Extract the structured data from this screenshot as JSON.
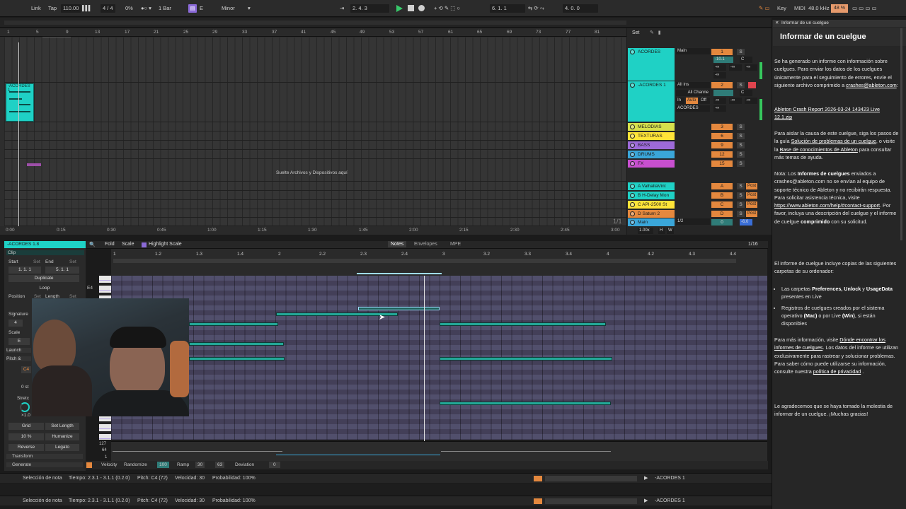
{
  "transport": {
    "link": "Link",
    "tap": "Tap",
    "tempo": "110.00",
    "signature": "4 / 4",
    "zoom": "0%",
    "quantize": "1 Bar",
    "key": "E",
    "scale": "Minor",
    "position": "2.   4.   3",
    "loop_start": "6.   1.   1",
    "loop_length": "4.   0.   0",
    "key_label": "Key",
    "midi_label": "MIDI",
    "sample_rate": "48.0 kHz",
    "cpu": "48 %"
  },
  "arrangement": {
    "ruler": [
      "1",
      "5",
      "9",
      "13",
      "17",
      "21",
      "25",
      "29",
      "33",
      "37",
      "41",
      "45",
      "49",
      "53",
      "57",
      "61",
      "65",
      "69",
      "73",
      "77",
      "81"
    ],
    "drop_hint": "Suelte Archivos y Dispositivos aquí",
    "clip_label": "-ACORDES 1",
    "time": [
      "0:00",
      "0:15",
      "0:30",
      "0:45",
      "1:00",
      "1:15",
      "1:30",
      "1:45",
      "2:00",
      "2:15",
      "2:30",
      "2:45",
      "3:00"
    ],
    "page_indicator": "1/1",
    "set_label": "Set"
  },
  "mixer": {
    "tracks": [
      {
        "name": "ACORDES",
        "num": "1",
        "color": "#1fd1c5",
        "route": "Main",
        "vol": "-10.1",
        "pan": "C"
      },
      {
        "name": "-ACORDES 1",
        "num": "2",
        "color": "#1fd1c5",
        "route": "All Ins",
        "channel": "All Channe",
        "mon_in": "In",
        "mon_auto": "Auto",
        "mon_off": "Off",
        "route_out": "ACORDES",
        "pan": "C"
      },
      {
        "name": "MELODIAS",
        "num": "3",
        "color": "#d6e04c"
      },
      {
        "name": "TEXTURAS",
        "num": "6",
        "color": "#ffe438"
      },
      {
        "name": "BASS",
        "num": "9",
        "color": "#9d6ad9"
      },
      {
        "name": "DRUMS",
        "num": "12",
        "color": "#3aa6d9"
      },
      {
        "name": "FX",
        "num": "15",
        "color": "#c84fcf"
      },
      {
        "name": "A ValhallaVint",
        "num": "A",
        "color": "#1fd1c5"
      },
      {
        "name": "B H-Delay Mon",
        "num": "B",
        "color": "#1fd1c5"
      },
      {
        "name": "C API-2500 St",
        "num": "C",
        "color": "#ffe438"
      },
      {
        "name": "D Saturn 2",
        "num": "D",
        "color": "#e4883e"
      },
      {
        "name": "Main",
        "num": "0",
        "color": "#3aa6d9",
        "route": "1/2",
        "vol": "-6.0"
      }
    ],
    "solo": "S",
    "post": "Post",
    "neg_inf": "-∞",
    "master_zoom": "1.00x",
    "h": "H",
    "w": "W"
  },
  "clip": {
    "title": "-ACORDES 1.8",
    "section": "Clip",
    "start": "Start",
    "end": "End",
    "set": "Set",
    "start_val": "1.   1.   1",
    "end_val": "5.   1.   1",
    "duplicate": "Duplicate",
    "loop": "Loop",
    "position": "Position",
    "length": "Length",
    "signature": "Signature",
    "sig_num": "4",
    "scale": "Scale",
    "scale_val": "E",
    "launch": "Launch",
    "pitch": "Pitch &",
    "pitch_val": "C4",
    "pitch_st": "0 st",
    "stretch": "Stretc",
    "stretch_val": "×1.0",
    "grid": "Grid",
    "set_length": "Set Length",
    "humanize_val": "10 %",
    "humanize": "Humanize",
    "reverse": "Reverse",
    "legato": "Legato",
    "transform": "Transform",
    "generate": "Generate"
  },
  "editor": {
    "fold": "Fold",
    "scale": "Scale",
    "highlight": "Highlight Scale",
    "notes_tab": "Notes",
    "envelopes_tab": "Envelopes",
    "mpe_tab": "MPE",
    "grid_res": "1/16",
    "ruler": [
      "1",
      "1.2",
      "1.3",
      "1.4",
      "2",
      "2.2",
      "2.3",
      "2.4",
      "3",
      "3.2",
      "3.3",
      "3.4",
      "4",
      "4.2",
      "4.3",
      "4.4"
    ],
    "key_e4": "E4",
    "vel_127": "127",
    "vel_64": "64",
    "vel_1": "1"
  },
  "velocity_bar": {
    "velocity": "Velocity",
    "randomize": "Randomize",
    "rand_val": "100",
    "ramp": "Ramp",
    "ramp_val": "30",
    "ramp_val2": "63",
    "deviation": "Deviation",
    "deviation_val": "0"
  },
  "status": {
    "selection": "Selección de nota",
    "time": "Tiempo: 2.3.1 - 3.1.1 (0.2.0)",
    "pitch": "Pitch: C4 (72)",
    "velocity": "Velocidad: 30",
    "probability": "Probabilidad: 100%",
    "track_name": "-ACORDES 1"
  },
  "crash": {
    "header": "Informar de un cuelgue",
    "title": "Informar de un cuelgue",
    "p1": "Se ha generado un informe con información sobre cuelgues. Para enviar los datos de los cuelgues únicamente para el seguimiento de errores, envíe el siguiente archivo comprimido a ",
    "email": "crashes@ableton.com",
    "p1_end": ":",
    "file": "Ableton Crash Report 2026-03-24 143423 Live 12.1.zip",
    "p2a": "Para aislar la causa de este cuelgue, siga los pasos de la guía ",
    "p2_link1": "Solución de problemas de un cuelgue",
    "p2b": ", o visite la ",
    "p2_link2": "Base de conocimientos de Ableton",
    "p2c": " para consultar más temas de ayuda.",
    "p3a": "Nota: Los ",
    "p3_bold": "Informes de cuelgues",
    "p3b": " enviados a crashes@ableton.com no se envían al equipo de soporte técnico de Ableton y no recibirán respuesta. Para solicitar asistencia técnica, visite ",
    "p3_link": "https://www.ableton.com/help/#contact-support",
    "p3c": ". Por favor, incluya una descripción del cuelgue y el informe de cuelgue ",
    "p3_bold2": "comprimido",
    "p3d": " con su solicitud.",
    "p4": "El informe de cuelgue incluye copias de las siguientes carpetas de su ordenador:",
    "li1a": "Las carpetas ",
    "li1_bold": "Preferences, Unlock",
    "li1b": " y ",
    "li1_bold2": "UsageData",
    "li1c": " presentes en Live",
    "li2a": "Registros de cuelgues creados por el sistema operativo ",
    "li2_bold": "(Mac)",
    "li2b": " o por Live ",
    "li2_bold2": "(Win)",
    "li2c": ", si están disponibles",
    "p5a": "Para más información, visite ",
    "p5_link1": "Dónde encontrar los informes de cuelgues",
    "p5b": ". Los datos del informe se utilizan exclusivamente para rastrear y solucionar problemas. Para saber cómo puede utilizarse su información, consulte nuestra ",
    "p5_link2": "política de privacidad",
    "p5c": " .",
    "p6": "Le agradecemos que se haya tomado la molestia de informar de un cuelgue. ¡Muchas gracias!"
  },
  "colors": {
    "accent": "#1fd1c5",
    "orange": "#e4883e",
    "play": "#37c96a"
  }
}
